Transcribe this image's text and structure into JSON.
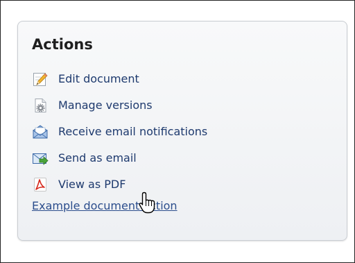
{
  "panel": {
    "title": "Actions",
    "items": [
      {
        "label": "Edit document",
        "icon": "pencil-icon"
      },
      {
        "label": "Manage versions",
        "icon": "document-gear-icon"
      },
      {
        "label": "Receive email notifications",
        "icon": "envelope-open-icon"
      },
      {
        "label": "Send as email",
        "icon": "envelope-arrow-icon"
      },
      {
        "label": "View as PDF",
        "icon": "pdf-icon"
      }
    ],
    "example_link": "Example document action"
  },
  "colors": {
    "link": "#2b4d8c",
    "label": "#1e3a6e",
    "title": "#1f1f1f",
    "panel_border": "#c9cdd2"
  },
  "cursor": {
    "icon": "hand-pointer-icon"
  }
}
